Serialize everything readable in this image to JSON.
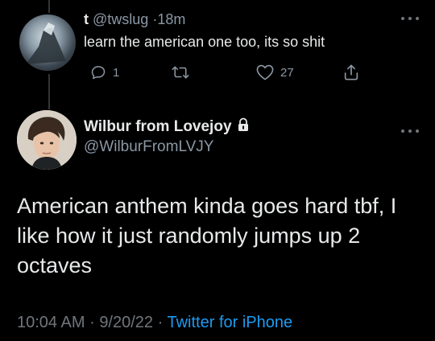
{
  "reply": {
    "name": "t",
    "handle": "@twslug",
    "separator": "·",
    "time": "18m",
    "text": "learn the american one too, its so shit",
    "reply_count": "1",
    "like_count": "27"
  },
  "tweet": {
    "author_name": "Wilbur from Lovejoy",
    "author_handle": "@WilburFromLVJY",
    "text": "American anthem kinda goes hard tbf, I like how it just randomly jumps up 2 octaves",
    "time": "10:04 AM",
    "date": "9/20/22",
    "separator": "·",
    "source": "Twitter for iPhone"
  },
  "colors": {
    "background": "#000000",
    "text": "#e7e9ea",
    "muted": "#8b98a5",
    "link": "#1d9bf0"
  },
  "icons": [
    "more-icon",
    "reply-icon",
    "retweet-icon",
    "like-icon",
    "share-icon",
    "lock-icon"
  ]
}
